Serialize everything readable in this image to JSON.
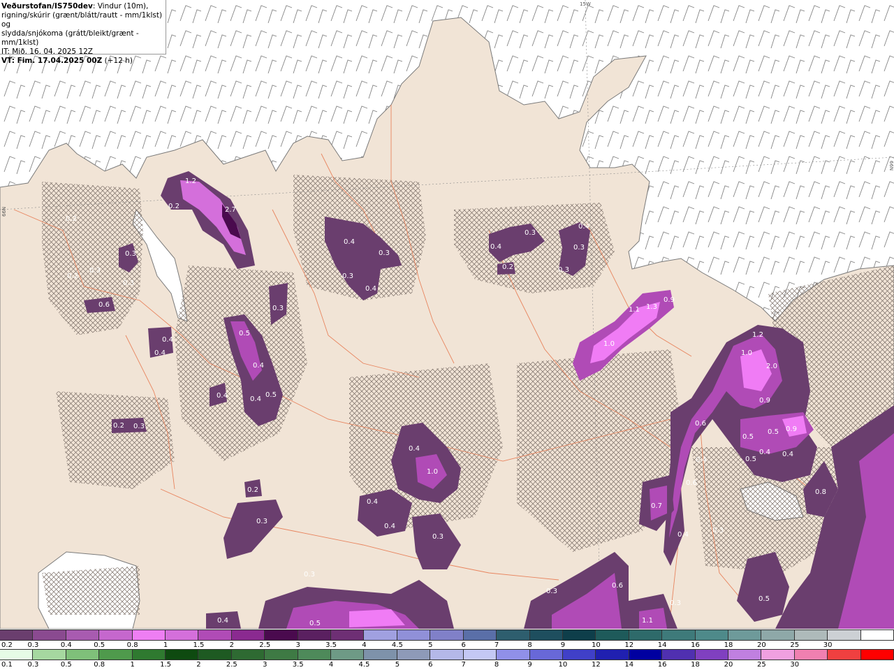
{
  "header": {
    "org": "Veðurstofan/IS750dev",
    "line1_rest": ": Vindur (10m),",
    "line2": "rigning/skúrir (grænt/blátt/rautt - mm/1klst) og",
    "line3": "slydda/snjókoma (grátt/bleikt/grænt - mm/1klst)",
    "it": "IT: Mið. 16. 04. 2025 12Z",
    "vt_main": "VT: Fim. 17.04.2025 00Z",
    "vt_offset": "(+12 h)"
  },
  "map": {
    "grid_labels": [
      "15W",
      "66N",
      "66N"
    ],
    "colors": {
      "sea": "#ffffff",
      "land": "#f1e4d6",
      "roads": "#e8845e",
      "coast": "#7a7a7a",
      "precip_light": "#6a3e6e",
      "precip_mid": "#b04bb6",
      "precip_heavy": "#f07cf5",
      "precip_peak": "#4a0a4e"
    },
    "values": [
      "1.2",
      "0.2",
      "2.7",
      "0.2",
      "0.3",
      "0.3",
      "0.2",
      "0.3",
      "0.6",
      "0.4",
      "0.4",
      "0.3",
      "0.5",
      "0.4",
      "0.5",
      "0.4",
      "0.4",
      "0.3",
      "0.4",
      "0.3",
      "0.4",
      "0.4",
      "0.3",
      "0.4",
      "0.2",
      "0.3",
      "0.3",
      "0.3",
      "1.1",
      "1.3",
      "0.9",
      "1.0",
      "1.2",
      "1.0",
      "2.0",
      "0.9",
      "0.6",
      "0.5",
      "0.5",
      "0.9",
      "0.5",
      "0.4",
      "0.4",
      "0.4",
      "0.6",
      "0.4",
      "1.0",
      "0.4",
      "0.4",
      "0.3",
      "0.7",
      "0.8",
      "0.4",
      "0.3",
      "0.2",
      "0.3",
      "0.2",
      "0.3",
      "0.3",
      "0.6",
      "0.5",
      "0.3",
      "1.1",
      "0.4",
      "0.5"
    ]
  },
  "legend_snow": {
    "colors": [
      "#6a3e6e",
      "#8a4a90",
      "#a85bb0",
      "#c567cd",
      "#ee7ef3",
      "#d46fdb",
      "#b04bb6",
      "#8a2a90",
      "#4a0a4e",
      "#5a2060",
      "#6e2f74",
      "#a0a0e0",
      "#9090d8",
      "#8080c8",
      "#5a6fa8",
      "#2e5e6e",
      "#1e4e5e",
      "#0e3e4a",
      "#1e5a5a",
      "#2e6a6a",
      "#3e7a7a",
      "#4e8a8a",
      "#6e9a9a",
      "#8ea8a8",
      "#aebaba",
      "#ccd0d4",
      "#ffffff"
    ],
    "labels": [
      "0.2",
      "0.3",
      "0.4",
      "0.5",
      "0.8",
      "1",
      "1.5",
      "2",
      "2.5",
      "3",
      "3.5",
      "4",
      "4.5",
      "5",
      "6",
      "7",
      "8",
      "9",
      "10",
      "12",
      "14",
      "16",
      "18",
      "20",
      "25",
      "30"
    ]
  },
  "legend_rain": {
    "colors": [
      "#e6fbe6",
      "#a6d8a0",
      "#7fc07a",
      "#4f9a4c",
      "#2f7a30",
      "#0e4a10",
      "#1e5a22",
      "#2e6a32",
      "#3e7a44",
      "#4e8a5a",
      "#6e9a86",
      "#7e92aa",
      "#8e9ab8",
      "#b4b8e8",
      "#c4c8f4",
      "#9090e8",
      "#6868d8",
      "#4040c8",
      "#2020b0",
      "#0000a0",
      "#5030b0",
      "#8040c0",
      "#c080e0",
      "#f0a0e0",
      "#f080b0",
      "#f04040",
      "#ff0000"
    ],
    "labels": [
      "0.1",
      "0.3",
      "0.5",
      "0.8",
      "1",
      "1.5",
      "2",
      "2.5",
      "3",
      "3.5",
      "4",
      "4.5",
      "5",
      "6",
      "7",
      "8",
      "9",
      "10",
      "12",
      "14",
      "16",
      "18",
      "20",
      "25",
      "30"
    ]
  }
}
